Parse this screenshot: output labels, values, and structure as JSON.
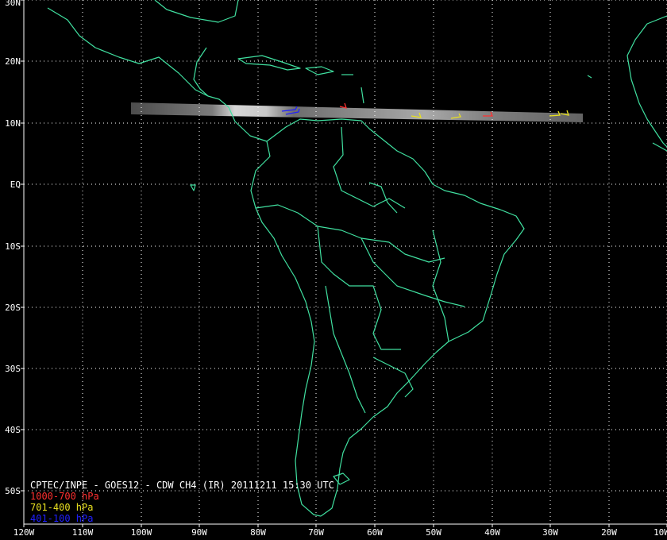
{
  "title": "CPTEC/INPE - GOES12 - CDW CH4 (IR) 20111211 15:30 UTC",
  "legend": [
    {
      "label": "1000-700 hPa",
      "color": "#ff3030"
    },
    {
      "label": "701-400 hPa",
      "color": "#e8e020"
    },
    {
      "label": "401-100 hPa",
      "color": "#2020ff"
    }
  ],
  "lat_labels": [
    "30N",
    "20N",
    "10N",
    "EQ",
    "10S",
    "20S",
    "30S",
    "40S",
    "50S"
  ],
  "lon_labels": [
    "120W",
    "110W",
    "100W",
    "90W",
    "80W",
    "70W",
    "60W",
    "50W",
    "40W",
    "30W",
    "20W",
    "10W"
  ],
  "colors": {
    "background": "#000000",
    "coastline": "#40e0a0",
    "grid": "#ffffff",
    "axis": "#ffffff"
  }
}
